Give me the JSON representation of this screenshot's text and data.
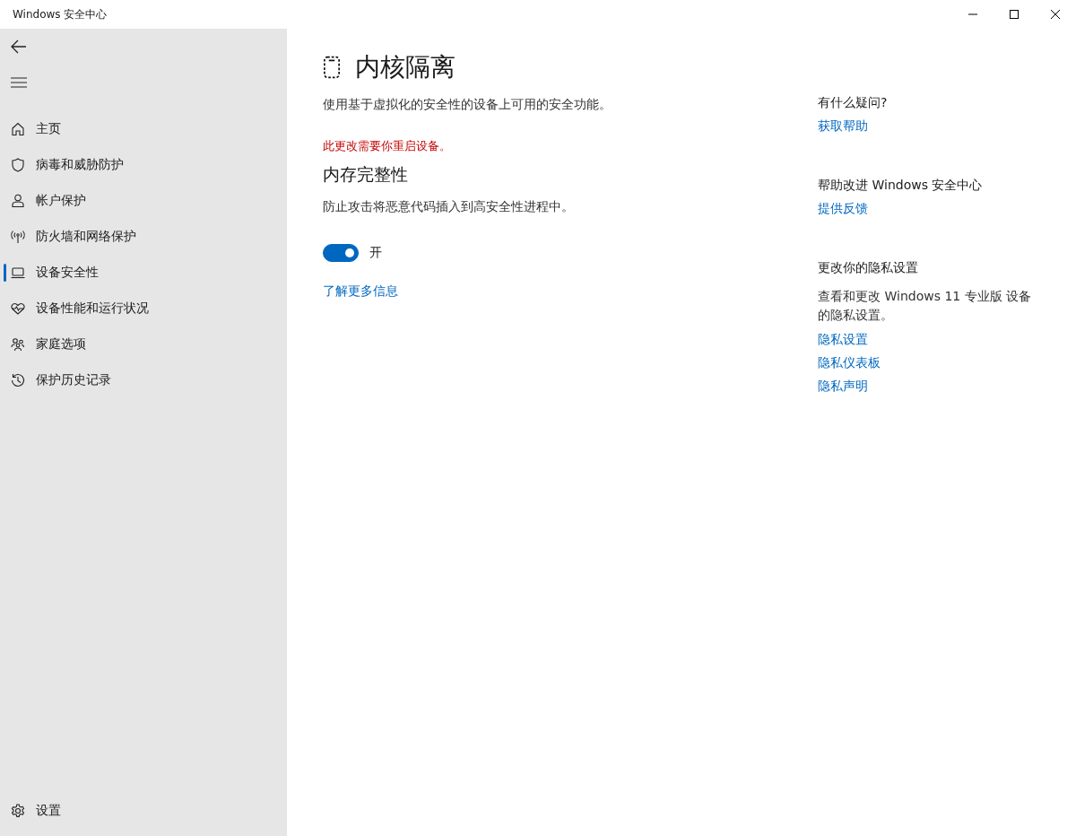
{
  "window": {
    "title": "Windows 安全中心"
  },
  "sidebar": {
    "items": [
      {
        "kind": "home",
        "label": "主页",
        "selected": false
      },
      {
        "kind": "shield",
        "label": "病毒和威胁防护",
        "selected": false
      },
      {
        "kind": "person",
        "label": "帐户保护",
        "selected": false
      },
      {
        "kind": "antenna",
        "label": "防火墙和网络保护",
        "selected": false
      },
      {
        "kind": "laptop",
        "label": "设备安全性",
        "selected": true
      },
      {
        "kind": "heart",
        "label": "设备性能和运行状况",
        "selected": false
      },
      {
        "kind": "family",
        "label": "家庭选项",
        "selected": false
      },
      {
        "kind": "history",
        "label": "保护历史记录",
        "selected": false
      }
    ],
    "settings": {
      "label": "设置"
    }
  },
  "page": {
    "title": "内核隔离",
    "description": "使用基于虚拟化的安全性的设备上可用的安全功能。",
    "warning": "此更改需要你重启设备。",
    "section": {
      "title": "内存完整性",
      "description": "防止攻击将恶意代码插入到高安全性进程中。",
      "toggle": {
        "on": true,
        "label": "开"
      }
    },
    "link": "了解更多信息"
  },
  "aside": [
    {
      "title": "有什么疑问?",
      "links": [
        "获取帮助"
      ]
    },
    {
      "title": "帮助改进 Windows 安全中心",
      "links": [
        "提供反馈"
      ]
    },
    {
      "title": "更改你的隐私设置",
      "text": "查看和更改 Windows 11 专业版 设备的隐私设置。",
      "links": [
        "隐私设置",
        "隐私仪表板",
        "隐私声明"
      ]
    }
  ]
}
